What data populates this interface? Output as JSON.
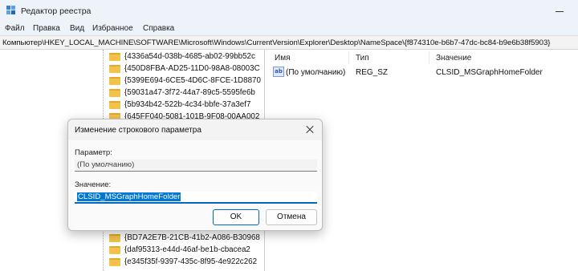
{
  "window": {
    "title": "Редактор реестра"
  },
  "menu": [
    "Файл",
    "Правка",
    "Вид",
    "Избранное",
    "Справка"
  ],
  "address": {
    "path": "Компьютер\\HKEY_LOCAL_MACHINE\\SOFTWARE\\Microsoft\\Windows\\CurrentVersion\\Explorer\\Desktop\\NameSpace\\{f874310e-b6b7-47dc-bc84-b9e6b38f5903}"
  },
  "tree": {
    "top_keys": [
      "{4336a54d-038b-4685-ab02-99bb52c",
      "{450D8FBA-AD25-11D0-98A8-08003C",
      "{5399E694-6CE5-4D6C-8FCE-1D8870",
      "{59031a47-3f72-44a7-89c5-5595fe6b",
      "{5b934b42-522b-4c34-bbfe-37a3ef7",
      "{645FF040-5081-101B-9F08-00AA002"
    ],
    "bottom_keys": [
      "{BD7A2E7B-21CB-41b2-A086-B30968",
      "{daf95313-e44d-46af-be1b-cbacea2",
      "{e345f35f-9397-435c-8f95-4e922c262"
    ]
  },
  "values": {
    "headers": {
      "name": "Имя",
      "type": "Тип",
      "data": "Значение"
    },
    "rows": [
      {
        "icon": "string-value-icon",
        "icon_text": "ab",
        "name": "(По умолчанию)",
        "type": "REG_SZ",
        "data": "CLSID_MSGraphHomeFolder"
      }
    ]
  },
  "dialog": {
    "title": "Изменение строкового параметра",
    "param_label": "Параметр:",
    "param_value": "(По умолчанию)",
    "value_label": "Значение:",
    "value_text": "CLSID_MSGraphHomeFolder",
    "ok_label": "OK",
    "cancel_label": "Отмена"
  },
  "colors": {
    "accent": "#0078d4",
    "folder": "#f1c34b",
    "chrome": "#eef2f9"
  }
}
